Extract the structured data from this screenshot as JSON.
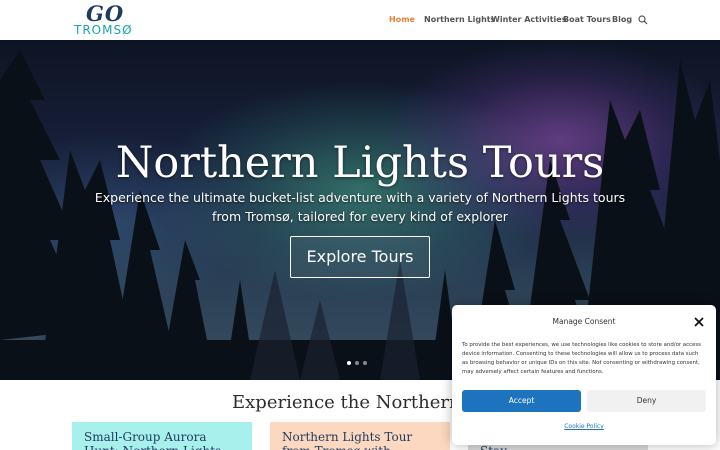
{
  "logo": {
    "top": "GO",
    "bottom": "TROMSØ"
  },
  "nav": {
    "items": [
      {
        "label": "Home",
        "active": true
      },
      {
        "label": "Northern Lights"
      },
      {
        "label": "Winter Activities"
      },
      {
        "label": "Boat Tours"
      },
      {
        "label": "Blog"
      }
    ],
    "search_icon": "search-icon",
    "active_color": "#e8813a"
  },
  "hero": {
    "title": "Northern Lights Tours",
    "subtitle": "Experience the ultimate bucket-list adventure with a variety of Northern Lights tours from Tromsø, tailored for every kind of explorer",
    "button": "Explore Tours",
    "slide_count": 3,
    "active_slide": 1
  },
  "section": {
    "title": "Experience the Northern Li",
    "cards": [
      {
        "title": "Small-Group Aurora Hunt: Northern Lights Tour from",
        "color": "#a8f0ec"
      },
      {
        "title": "Northern Lights Tour from Tromsø with Unlimited",
        "color": "#fbd8bf"
      },
      {
        "title": "Aurora Crystal Lavvu Stay",
        "color": "#d8d8d8"
      }
    ]
  },
  "consent": {
    "title": "Manage Consent",
    "body": "To provide the best experiences, we use technologies like cookies to store and/or access device information. Consenting to these technologies will allow us to process data such as browsing behavior or unique IDs on this site. Not consenting or withdrawing consent, may adversely affect certain features and functions.",
    "accept": "Accept",
    "deny": "Deny",
    "policy_link": "Cookie Policy",
    "accent": "#1e73be"
  }
}
